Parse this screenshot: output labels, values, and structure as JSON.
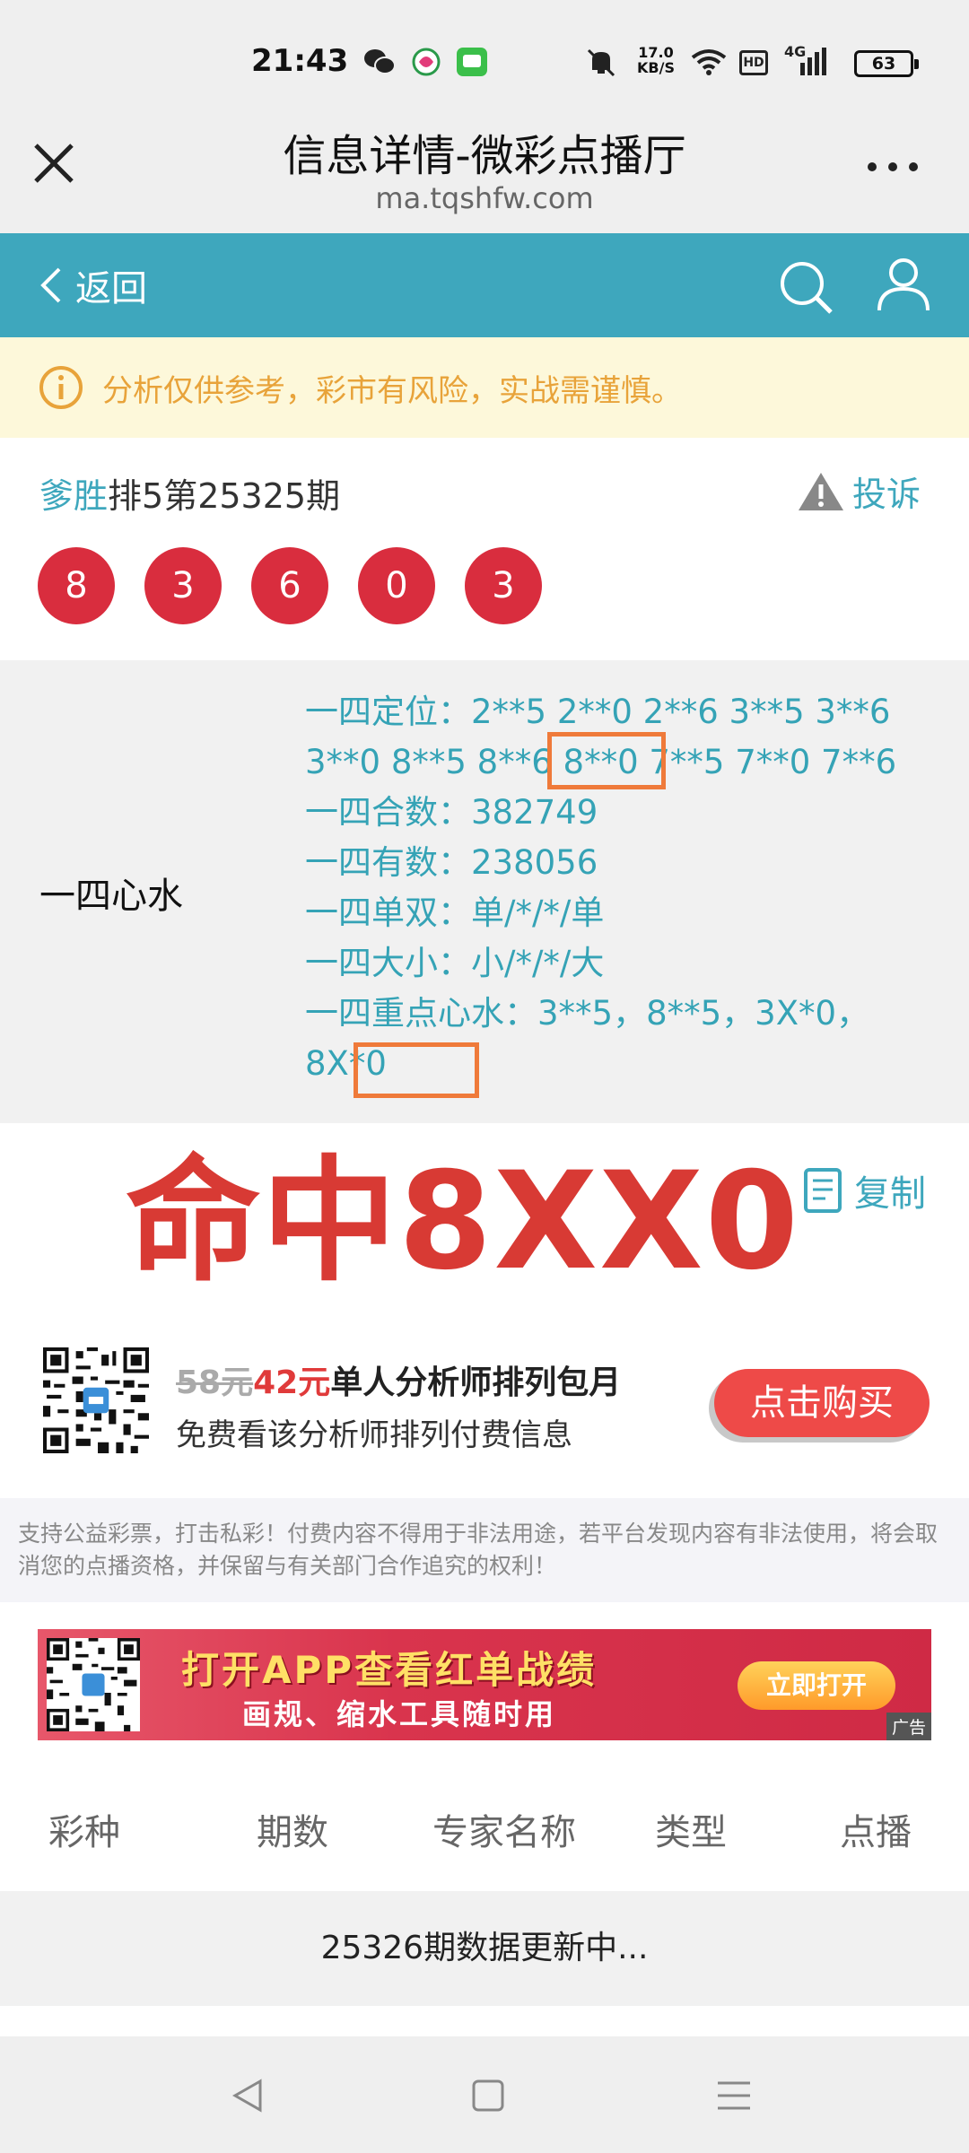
{
  "status_bar": {
    "time": "21:43",
    "net_speed_top": "17.0",
    "net_speed_bottom": "KB/S",
    "hd": "HD",
    "network": "4G",
    "battery": "63"
  },
  "browser": {
    "title": "信息详情-微彩点播厅",
    "url": "ma.tqshfw.com"
  },
  "nav": {
    "back_label": "返回"
  },
  "notice": {
    "text": "分析仅供参考，彩市有风险，实战需谨慎。"
  },
  "draw": {
    "author": "爹胜",
    "issue_text": "排5第25325期",
    "report_label": "投诉",
    "numbers": [
      "8",
      "3",
      "6",
      "0",
      "3"
    ]
  },
  "content": {
    "label": "一四心水",
    "lines": [
      "一四定位：2**5 2**0 2**6 3**5 3**6 3**0 8**5 8**6 8**0 7**5 7**0 7**6",
      "一四合数：382749",
      "一四有数：238056",
      "一四单双：单/*/*/单",
      "一四大小：小/*/*/大",
      "一四重点心水：3**5，8**5，3X*0，8X*0"
    ]
  },
  "overlay": {
    "hit_text": "命中8XX0",
    "highlight_color": "#ef7a3a"
  },
  "copy": {
    "label": "复制"
  },
  "purchase": {
    "old_price": "58元",
    "new_price": "42元",
    "title": "单人分析师排列包月",
    "subtitle": "免费看该分析师排列付费信息",
    "button": "点击购买"
  },
  "disclaimer": "支持公益彩票，打击私彩！付费内容不得用于非法用途，若平台发现内容有非法使用，将会取消您的点播资格，并保留与有关部门合作追究的权利！",
  "banner": {
    "headline": "打开APP查看红单战绩",
    "subline": "画规、缩水工具随时用",
    "button": "立即打开",
    "ad_tag": "广告"
  },
  "table": {
    "headers": [
      "彩种",
      "期数",
      "专家名称",
      "类型",
      "点播"
    ],
    "status_row": "25326期数据更新中..."
  },
  "colors": {
    "accent": "#3ea7bd",
    "ball": "#d92d3e",
    "notice_text": "#e8a33a",
    "buy": "#ee4a48"
  }
}
